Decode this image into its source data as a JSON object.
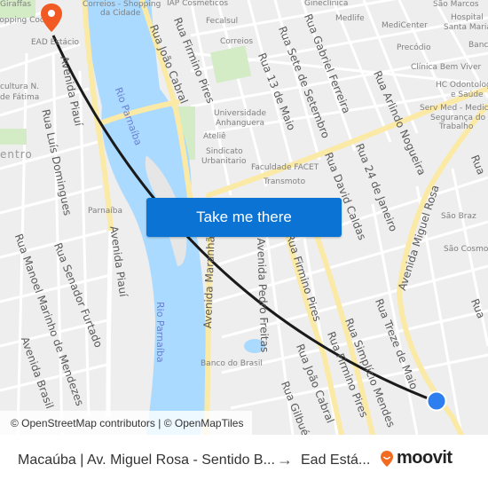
{
  "map": {
    "river_labels": [
      "Rio Parnaíba",
      "Rio Parnaíba"
    ],
    "streets": {
      "avenida_piaui_top": "Avenida Piauí",
      "avenida_piaui_mid": "Avenida Piauí",
      "rua_luis_domingues": "Rua Luís Domingues",
      "rua_joao_cabral_top": "Rua João Cabral",
      "rua_firmino_pires_top": "Rua Firmino Pires",
      "rua_13_de_maio": "Rua 13 de Maio",
      "rua_sete_de_setembro": "Rua Sete de Setembro",
      "rua_gabriel_ferreira": "Rua Gabriel Ferreira",
      "rua_arlindo_nogueira": "Rua Arlindo Nogueira",
      "rua_david_caldas": "Rua David Caldas",
      "rua_24_de_janeiro": "Rua 24 de Janeiro",
      "avenida_miguel_rosa": "Avenida Miguel Rosa",
      "rua_manoel_marinho": "Rua Manoel Marinho de Mendezes",
      "rua_senador_furtado": "Rua Senador Furtado",
      "avenida_brasil": "Avenida Brasil",
      "avenida_maranhao": "Avenida Maranhão",
      "avenida_pedro_freitas": "Avenida Pedro Freitas",
      "rua_firmino_pires_mid": "Rua Firmino Pires",
      "rua_firmino_pires_low": "Rua Firmino Pires",
      "rua_joao_cabral_low": "Rua João Cabral",
      "rua_gilbues": "Rua Gilbués",
      "rua_simplicio_mendes": "Rua Simplício Mendes",
      "rua_treze_de_maio": "Rua Treze de Maio",
      "rua_right_1": "Rua",
      "rua_right_2": "Rua"
    },
    "pois": {
      "giraffas": "Giraffas",
      "shopping_cocais": "Shopping Cocais",
      "ead_estacio": "EAD Estácio",
      "correios_shopping": "Correios - Shopping",
      "da_cidade": "da Cidade",
      "iap": "IAP Cosméticos",
      "fecalsul": "Fecalsul",
      "correios": "Correios",
      "gineclinica": "Gineclínica",
      "medlife": "Medlife",
      "sao_marcos": "São Marcos",
      "hospital": "Hospital",
      "santa_maria": "Santa Maria",
      "medicenter": "MediCenter",
      "banco": "Banco",
      "precodio": "Precódio",
      "clinica_bem_viver": "Clínica Bem Viver",
      "hc_odonto": "HC Odontologia",
      "e_saude": "e Saúde",
      "serv_med": "Serv Med - Medicina",
      "seguranca": "Segurança do",
      "trabalho": "Trabalho",
      "cultura": "cultura N.",
      "fatima": "de Fátima",
      "universidade": "Universidade",
      "anhanguera": "Anhanguera",
      "atelie": "Ateliê",
      "sindicato": "Sindicato",
      "urbanitario": "Urbanitario",
      "facet": "Faculdade FACET",
      "transmoto": "Transmoto",
      "centro": "entro",
      "parnaiba": "Parnaíba",
      "sao_braz": "São Braz",
      "sao_cosmo": "São Cosmo",
      "banco_brasil": "Banco do Brasil"
    },
    "colors": {
      "background": "#eeeeee",
      "water": "#aadaff",
      "major_road": "#fbe9a6",
      "park": "#d3ecc6",
      "route_line": "#1a1a1a",
      "destination_pin": "#f25a24",
      "origin_dot": "#2d7ff0"
    }
  },
  "cta": {
    "label": "Take me there"
  },
  "attribution": {
    "text": "© OpenStreetMap contributors | © OpenMapTiles"
  },
  "footer": {
    "from": "Macaúba | Av. Miguel Rosa - Sentido B...",
    "arrow": "→",
    "to": "Ead Está...",
    "brand": "moovit",
    "brand_color": "#f26b21"
  }
}
